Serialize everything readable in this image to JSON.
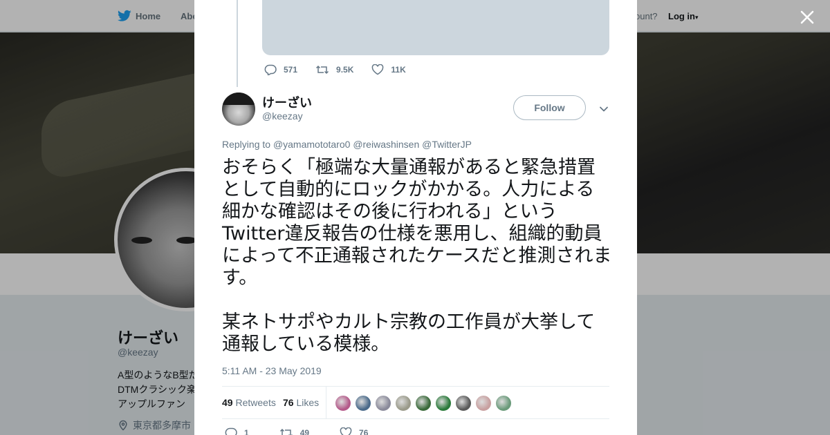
{
  "nav": {
    "home_label": "Home",
    "about_label": "Abo",
    "account_prompt": "ccount?",
    "login_label": "Log in"
  },
  "profile": {
    "name": "けーざい",
    "handle": "@keezay",
    "bio_lines": [
      "A型のようなB型だ",
      "DTMクラシック楽",
      "アップルファン"
    ],
    "location": "東京都多摩市"
  },
  "prev_tweet": {
    "replies": "571",
    "retweets": "9.5K",
    "likes": "11K"
  },
  "tweet": {
    "author_name": "けーざい",
    "author_handle": "@keezay",
    "follow_label": "Follow",
    "replying_label": "Replying to",
    "mentions": [
      "@yamamototaro0",
      "@reiwashinsen",
      "@TwitterJP"
    ],
    "paragraph1": "おそらく「極端な大量通報があると緊急措置として自動的にロックがかかる。人力による細かな確認はその後に行われる」というTwitter違反報告の仕様を悪用し、組織的動員によって不正通報されたケースだと推測されます。",
    "paragraph2": "某ネトサポやカルト宗教の工作員が大挙して通報している模様。",
    "timestamp": "5:11 AM - 23 May 2019",
    "retweet_count": "49",
    "retweet_label": "Retweets",
    "like_count": "76",
    "like_label": "Likes",
    "liker_colors": [
      "#b45a8a",
      "#4a6a8a",
      "#8a8a9a",
      "#9a9a8a",
      "#3a6a3a",
      "#2a7a3a",
      "#5a5a5a",
      "#c8a0a0",
      "#6a9a7a"
    ],
    "actions": {
      "replies": "1",
      "retweets": "49",
      "likes": "76"
    }
  },
  "colors": {
    "twitter_blue": "#1da1f2",
    "secondary_text": "#657786"
  }
}
